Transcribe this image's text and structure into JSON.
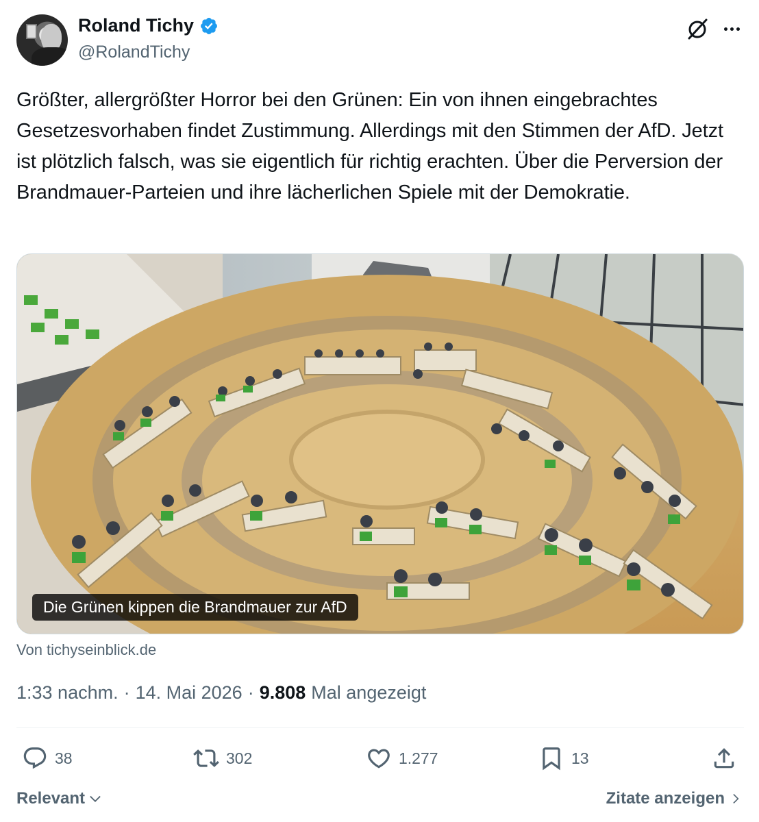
{
  "author": {
    "name": "Roland Tichy",
    "handle": "@RolandTichy"
  },
  "tweet": {
    "text": "Größter, allergrößter Horror bei den Grünen: Ein von ihnen eingebrachtes Gesetzesvorhaben findet Zustimmung. Allerdings mit den Stimmen der AfD. Jetzt ist plötzlich falsch, was sie eigentlich für richtig erachten. Über die Perversion der Brandmauer-Parteien und ihre lächerlichen Spiele mit der Demokratie."
  },
  "card": {
    "caption": "Die Grünen kippen die Brandmauer zur AfD",
    "source": "Von tichyseinblick.de"
  },
  "meta": {
    "time": "1:33 nachm.",
    "sep1": "·",
    "date": "14. Mai 2026",
    "sep2": "·",
    "views_count": "9.808",
    "views_label": "Mal angezeigt"
  },
  "actions": {
    "replies": "38",
    "reposts": "302",
    "likes": "1.277",
    "bookmarks": "13"
  },
  "footer": {
    "sort_label": "Relevant",
    "quotes_label": "Zitate anzeigen"
  },
  "colors": {
    "verified": "#1d9bf0",
    "muted": "#536471",
    "text": "#0f1419"
  }
}
